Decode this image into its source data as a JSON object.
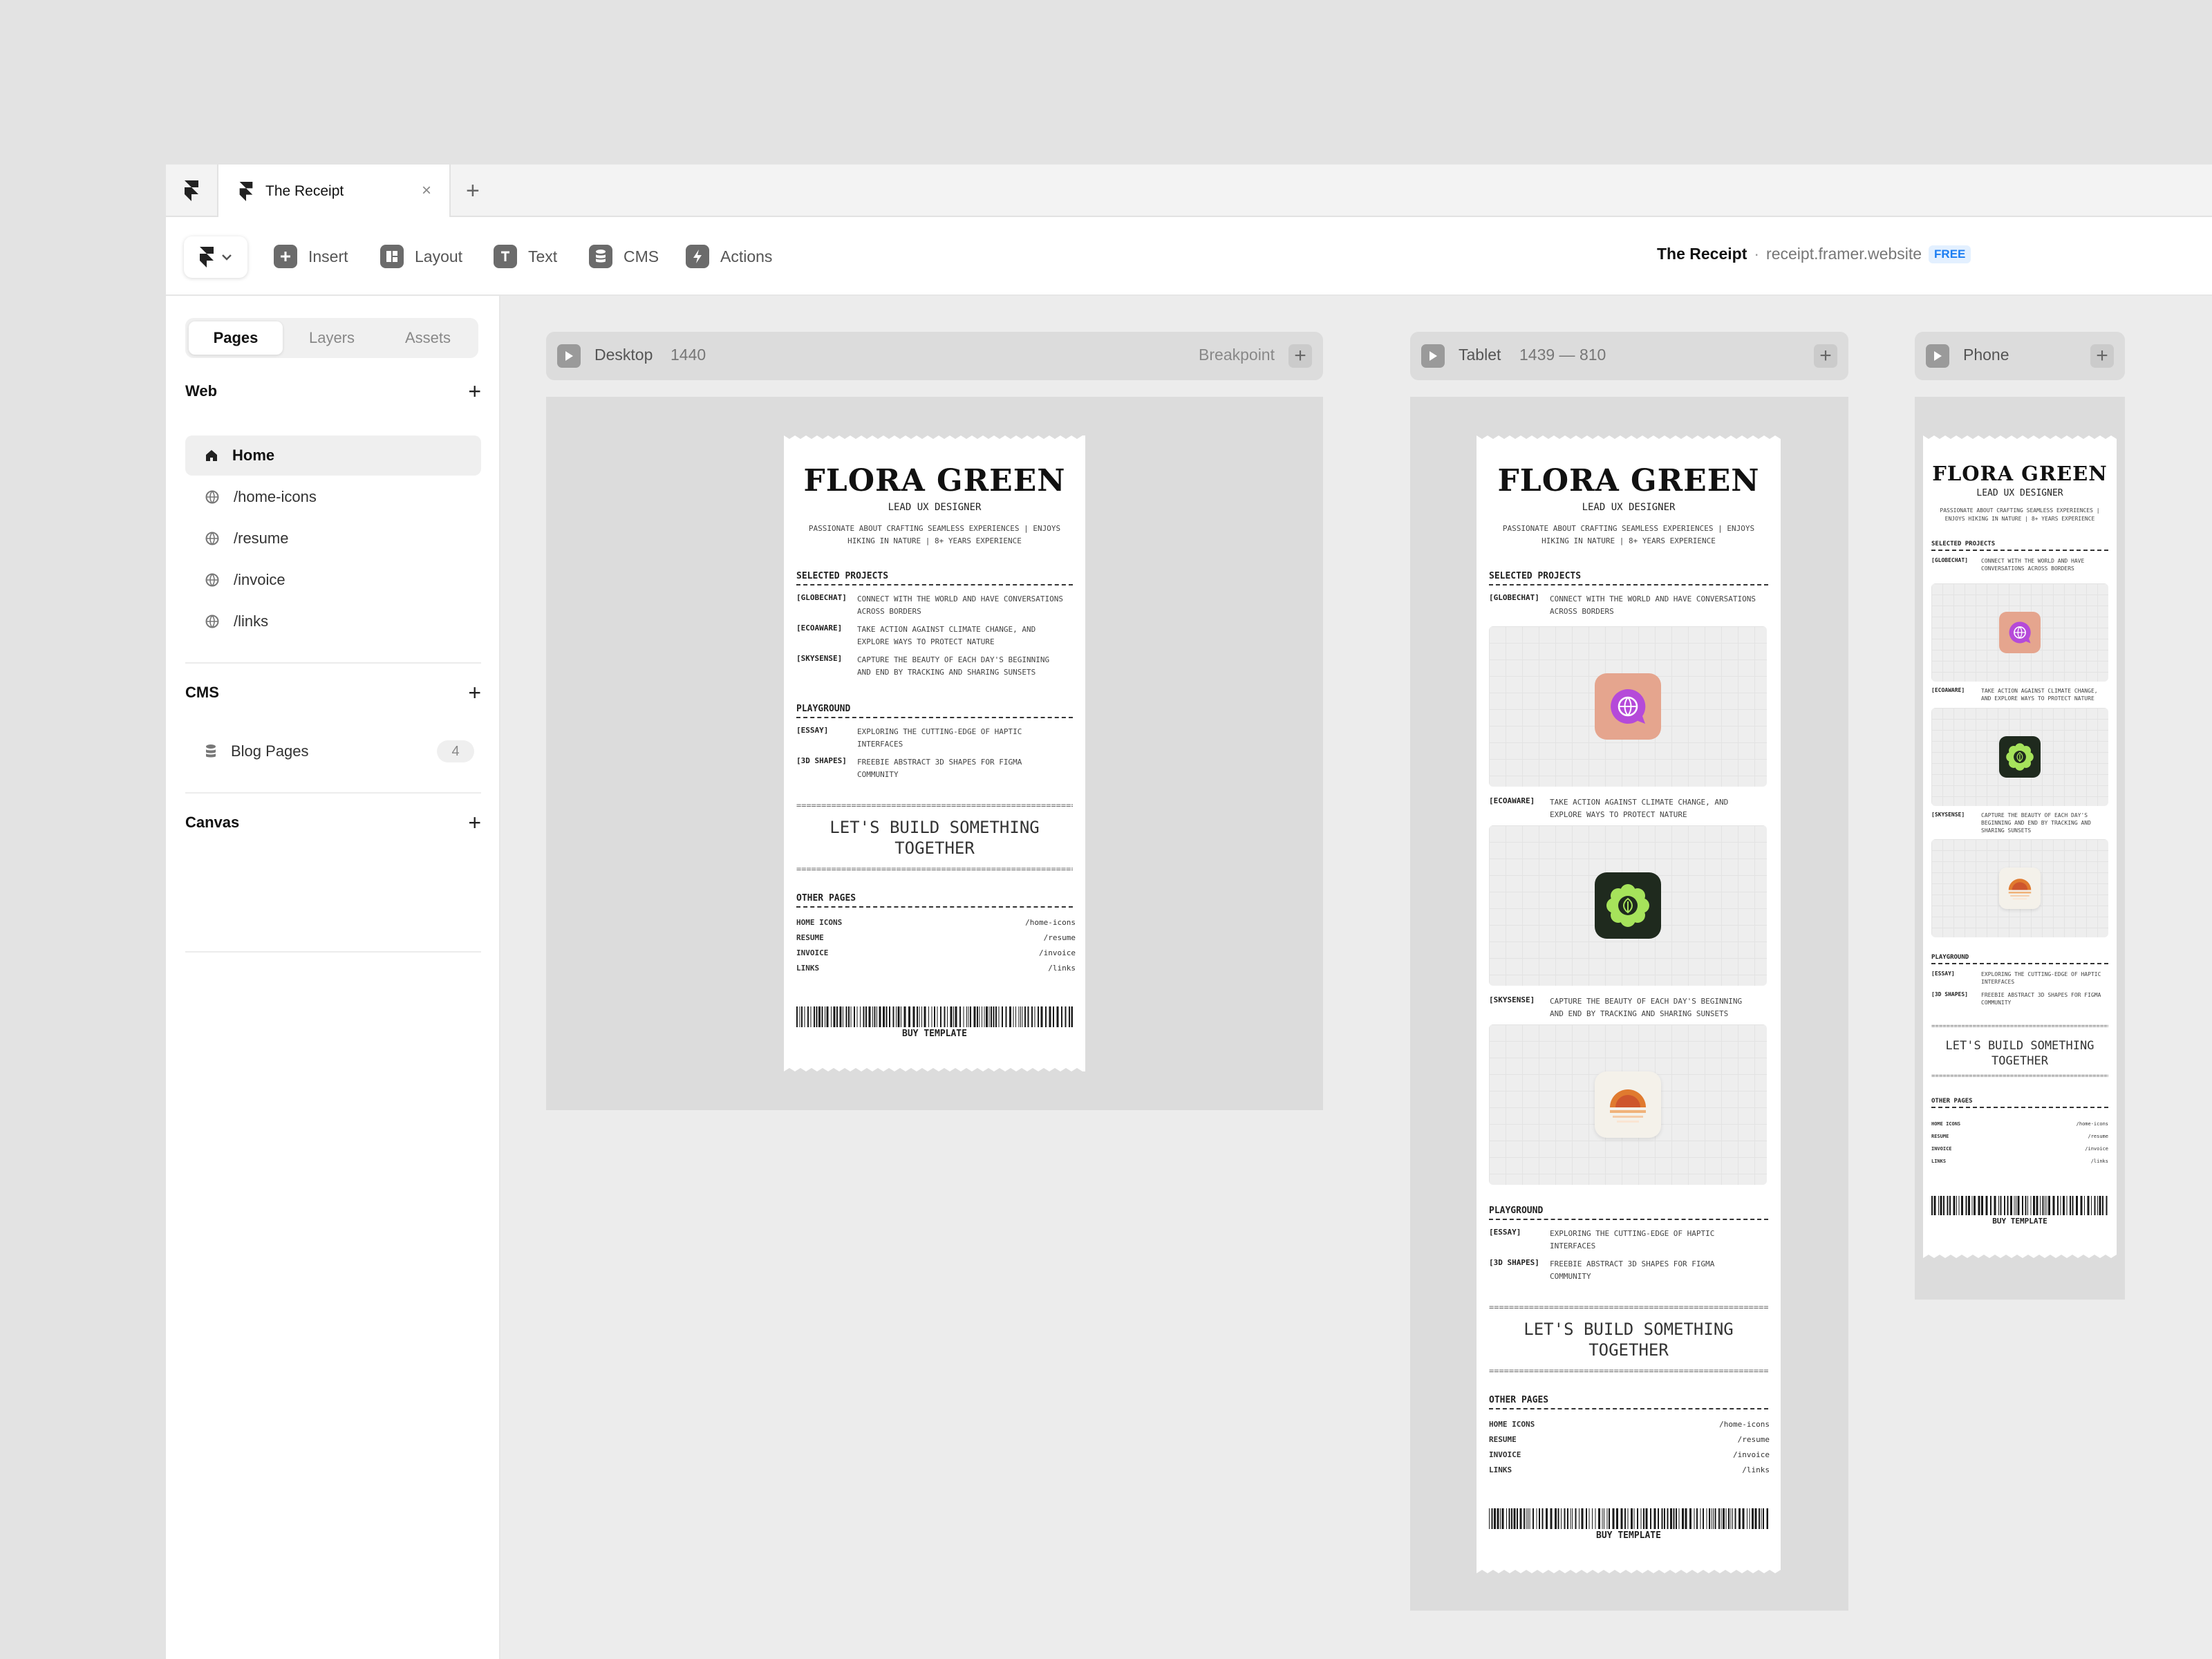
{
  "tabs": {
    "document_title": "The Receipt",
    "close": "×",
    "new": "+"
  },
  "toolbar": {
    "items": [
      {
        "label": "Insert",
        "icon": "plus-icon"
      },
      {
        "label": "Layout",
        "icon": "layout-icon"
      },
      {
        "label": "Text",
        "icon": "text-icon"
      },
      {
        "label": "CMS",
        "icon": "database-icon"
      },
      {
        "label": "Actions",
        "icon": "bolt-icon"
      }
    ],
    "site_name": "The Receipt",
    "separator": "·",
    "site_url": "receipt.framer.website",
    "plan_badge": "FREE"
  },
  "sidebar": {
    "tabs": [
      "Pages",
      "Layers",
      "Assets"
    ],
    "web": {
      "label": "Web",
      "add": "+"
    },
    "pages": [
      {
        "label": "Home",
        "icon": "home-icon"
      },
      {
        "label": "/home-icons",
        "icon": "globe-icon"
      },
      {
        "label": "/resume",
        "icon": "globe-icon"
      },
      {
        "label": "/invoice",
        "icon": "globe-icon"
      },
      {
        "label": "/links",
        "icon": "globe-icon"
      }
    ],
    "cms": {
      "label": "CMS",
      "add": "+",
      "collection": "Blog Pages",
      "count": "4"
    },
    "canvas": {
      "label": "Canvas",
      "add": "+"
    }
  },
  "breakpoints": {
    "desktop": {
      "name": "Desktop",
      "size": "1440",
      "right": "Breakpoint"
    },
    "tablet": {
      "name": "Tablet",
      "size": "1439 — 810"
    },
    "phone": {
      "name": "Phone"
    }
  },
  "receipt": {
    "name": "FLORA GREEN",
    "role": "LEAD UX DESIGNER",
    "about1": "PASSIONATE ABOUT CRAFTING SEAMLESS EXPERIENCES | ENJOYS",
    "about2": "HIKING IN NATURE |  8+ YEARS EXPERIENCE",
    "about_p1": "PASSIONATE ABOUT CRAFTING SEAMLESS EXPERIENCES |",
    "about_p2": "ENJOYS HIKING IN NATURE |  8+ YEARS EXPERIENCE",
    "selected_heading": "SELECTED PROJECTS",
    "projects": [
      {
        "tag": "[GLOBECHAT]",
        "l1": "CONNECT WITH THE WORLD AND HAVE CONVERSATIONS",
        "l2": "ACROSS BORDERS",
        "p1": "CONNECT WITH THE WORLD AND HAVE",
        "p2": "CONVERSATIONS ACROSS BORDERS"
      },
      {
        "tag": "[ECOAWARE]",
        "l1": "TAKE ACTION AGAINST CLIMATE CHANGE, AND",
        "l2": "EXPLORE WAYS TO PROTECT NATURE",
        "p1": "TAKE ACTION AGAINST CLIMATE CHANGE,",
        "p2": "AND EXPLORE WAYS TO PROTECT NATURE"
      },
      {
        "tag": "[SKYSENSE]",
        "l1": "CAPTURE THE BEAUTY OF EACH DAY'S BEGINNING",
        "l2": "AND END BY TRACKING AND SHARING SUNSETS",
        "p1": "CAPTURE THE BEAUTY OF EACH DAY'S",
        "p2": "BEGINNING AND END BY TRACKING AND",
        "p3": "SHARING SUNSETS"
      }
    ],
    "playground_heading": "PLAYGROUND",
    "playground": [
      {
        "tag": "[ESSAY]",
        "l1": "EXPLORING THE CUTTING-EDGE OF HAPTIC",
        "l2": "INTERFACES"
      },
      {
        "tag": "[3D SHAPES]",
        "l1": "FREEBIE ABSTRACT 3D SHAPES FOR FIGMA",
        "l2": "COMMUNITY"
      }
    ],
    "equals": "==============================================================",
    "cta1": "LET'S BUILD SOMETHING",
    "cta2": "TOGETHER",
    "other_heading": "OTHER PAGES",
    "links": [
      {
        "label": "HOME ICONS",
        "path": "/home-icons"
      },
      {
        "label": "RESUME",
        "path": "/resume"
      },
      {
        "label": "INVOICE",
        "path": "/invoice"
      },
      {
        "label": "LINKS",
        "path": "/links"
      }
    ],
    "buy": "BUY TEMPLATE"
  },
  "colors": {
    "accent": "#1c7ef2",
    "globechat_bg": "#e5a58e",
    "globechat_fg": "#b54ad9",
    "ecoaware_bg": "#1f2a1e",
    "ecoaware_fg": "#a6e35b",
    "skysense_bg": "#f4f1ea",
    "skysense_fg": "#e07a2f"
  }
}
